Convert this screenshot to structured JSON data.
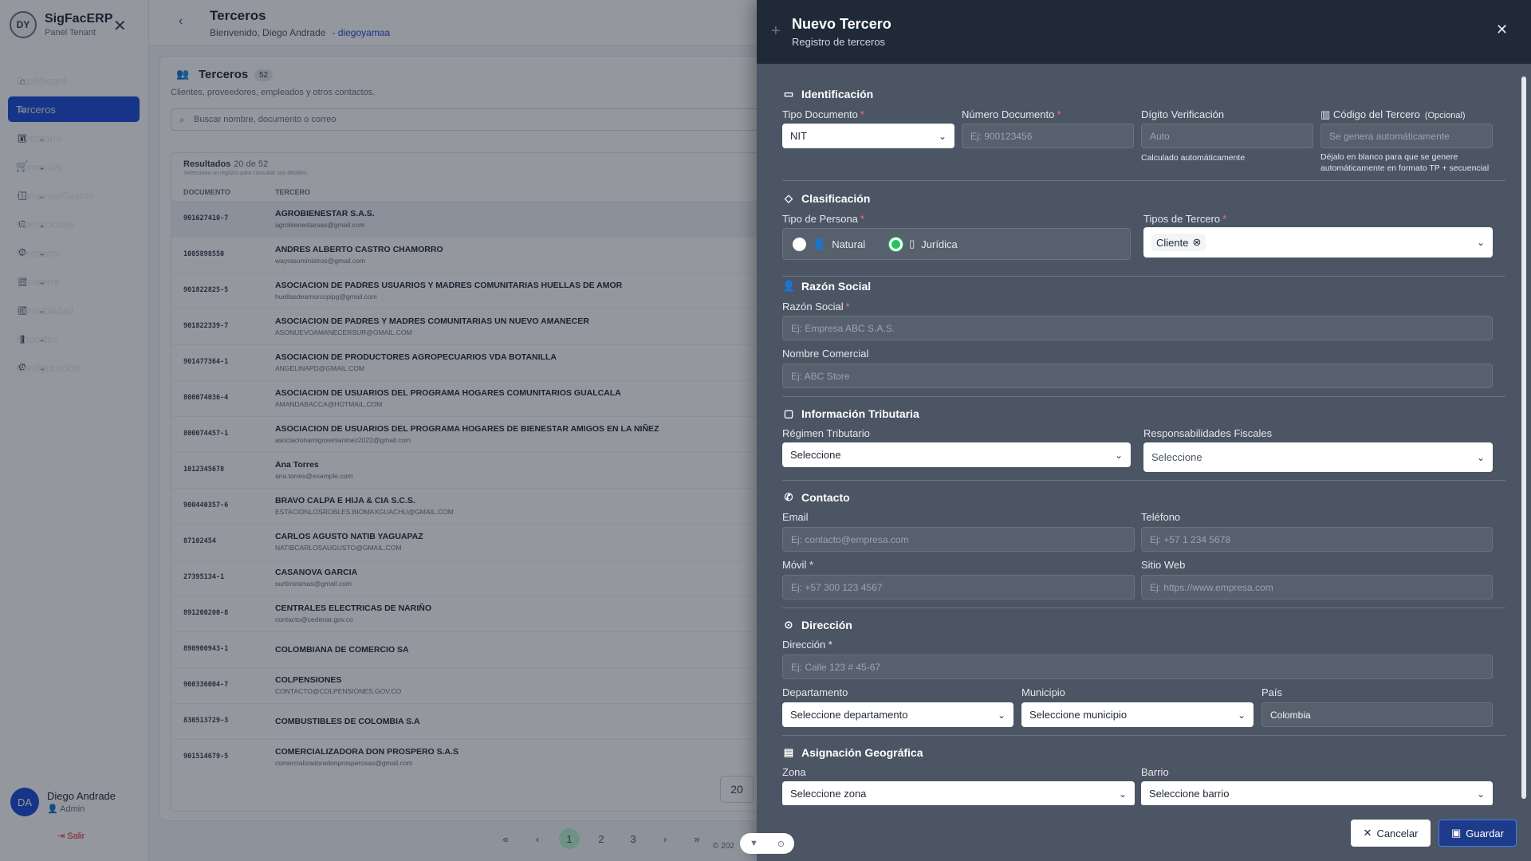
{
  "brand": {
    "title": "SigFacERP",
    "subtitle": "Panel Tenant",
    "logo_text": "DY"
  },
  "sidebar": {
    "items": [
      {
        "label": "Dashboard",
        "icon": "home-icon",
        "chevron": false,
        "active": false
      },
      {
        "label": "Terceros",
        "icon": "id-card-icon",
        "chevron": false,
        "active": true
      },
      {
        "label": "Inventario",
        "icon": "box-icon",
        "chevron": true,
        "active": false
      },
      {
        "label": "Comercial",
        "icon": "cart-icon",
        "chevron": true,
        "active": false
      },
      {
        "label": "Compras/Gastos",
        "icon": "bag-icon",
        "chevron": true,
        "active": false
      },
      {
        "label": "Operaciones",
        "icon": "pin-icon",
        "chevron": true,
        "active": false
      },
      {
        "label": "Procesos",
        "icon": "gear-icon",
        "chevron": true,
        "active": false
      },
      {
        "label": "Tesorería",
        "icon": "wallet-icon",
        "chevron": true,
        "active": false
      },
      {
        "label": "Contabilidad",
        "icon": "ledger-icon",
        "chevron": true,
        "active": false
      },
      {
        "label": "Reportes",
        "icon": "bar-chart-icon",
        "chevron": true,
        "active": false
      },
      {
        "label": "Configuración",
        "icon": "cog-icon",
        "chevron": true,
        "active": false
      }
    ],
    "user": {
      "initials": "DA",
      "name": "Diego Andrade",
      "role": "Admin"
    },
    "logout": "Salir"
  },
  "header": {
    "title": "Terceros",
    "welcome": "Bienvenido, Diego Andrade",
    "username": "- diegoyamaa"
  },
  "list": {
    "title": "Terceros",
    "count": "52",
    "description": "Clientes, proveedores, empleados y otros contactos.",
    "search_placeholder": "Buscar nombre, documento o correo",
    "results_label": "Resultados",
    "results_count": "20 de 52",
    "hint": "Selecciona un registro para consultar sus detalles.",
    "col_doc": "DOCUMENTO",
    "col_tercero": "TERCERO",
    "rows": [
      {
        "doc": "901627410-7",
        "name": "AGROBIENESTAR S.A.S.",
        "email": "agrobienestarsas@gmail.com"
      },
      {
        "doc": "1085898550",
        "name": "ANDRES ALBERTO CASTRO CHAMORRO",
        "email": "wayrasuministros@gmail.com"
      },
      {
        "doc": "901822825-5",
        "name": "ASOCIACION DE PADRES USUARIOS Y MADRES COMUNITARIAS HUELLAS DE AMOR",
        "email": "huellasdeamorccpipg@gmail.com"
      },
      {
        "doc": "901822339-7",
        "name": "ASOCIACION DE PADRES Y MADRES COMUNITARIAS UN NUEVO AMANECER",
        "email": "ASONUEVOAMANECERSUR@GMAIL.COM"
      },
      {
        "doc": "901477364-1",
        "name": "ASOCIACION DE PRODUCTORES AGROPECUARIOS VDA BOTANILLA",
        "email": "ANGELINAPD@GMAIL.COM"
      },
      {
        "doc": "800074036-4",
        "name": "ASOCIACION DE USUARIOS DEL PROGRAMA HOGARES COMUNITARIOS GUALCALA",
        "email": "AMANDABACCA@HOTMAIL.COM"
      },
      {
        "doc": "800074457-1",
        "name": "ASOCIACION DE USUARIOS DEL PROGRAMA HOGARES DE BIENESTAR AMIGOS EN LA NIÑEZ",
        "email": "asociacionamigosenlaninez2022@gmail.com"
      },
      {
        "doc": "1012345678",
        "name": "Ana Torres",
        "email": "ana.torres@example.com"
      },
      {
        "doc": "900440357-6",
        "name": "BRAVO CALPA E HIJA & CIA S.C.S.",
        "email": "ESTACIONLOSROBLES.BIOMAXGUACHU@GMAIL.COM"
      },
      {
        "doc": "87102454",
        "name": "CARLOS AGUSTO NATIB YAGUAPAZ",
        "email": "NATIBCARLOSAUGUSTO@GMAIL.COM"
      },
      {
        "doc": "27395134-1",
        "name": "CASANOVA GARCIA",
        "email": "surtimiramas@gmail.com"
      },
      {
        "doc": "891200200-8",
        "name": "CENTRALES ELECTRICAS DE NARIÑO",
        "email": "contacto@cedenar.gov.co"
      },
      {
        "doc": "890900943-1",
        "name": "COLOMBIANA DE COMERCIO SA",
        "email": ""
      },
      {
        "doc": "900336004-7",
        "name": "COLPENSIONES",
        "email": "CONTACTO@COLPENSIONES.GOV.CO"
      },
      {
        "doc": "830513729-3",
        "name": "COMBUSTIBLES DE COLOMBIA S.A",
        "email": ""
      },
      {
        "doc": "901514679-5",
        "name": "COMERCIALIZADORA DON PROSPERO S.A.S",
        "email": "comercializadoradonprosperosas@gmail.com"
      }
    ],
    "pagination": {
      "first": "«",
      "prev": "‹",
      "pages": [
        "1",
        "2",
        "3"
      ],
      "current": "1",
      "next": "›",
      "last": "»",
      "page_size": "20"
    },
    "footer": "© 202"
  },
  "drawer": {
    "title": "Nuevo Tercero",
    "subtitle": "Registro de terceros",
    "identificacion": {
      "heading": "Identificación",
      "tipo_doc_label": "Tipo Documento",
      "tipo_doc_value": "NIT",
      "numero_doc_label": "Número Documento",
      "numero_doc_placeholder": "Ej: 900123456",
      "digito_label": "Dígito Verificación",
      "digito_placeholder": "Auto",
      "digito_hint": "Calculado automáticamente",
      "codigo_label": "Código del Tercero",
      "codigo_opt": "(Opcional)",
      "codigo_placeholder": "Se genera automáticamente",
      "codigo_hint": "Déjalo en blanco para que se genere automáticamente en formato TP + secuencial"
    },
    "clasificacion": {
      "heading": "Clasificación",
      "tipo_persona_label": "Tipo de Persona",
      "natural": "Natural",
      "juridica": "Jurídica",
      "tipos_tercero_label": "Tipos de Tercero",
      "chip": "Cliente"
    },
    "razon": {
      "heading": "Razón Social",
      "razon_label": "Razón Social",
      "razon_placeholder": "Ej: Empresa ABC S.A.S.",
      "nombre_label": "Nombre Comercial",
      "nombre_placeholder": "Ej: ABC Store"
    },
    "tributaria": {
      "heading": "Información Tributaria",
      "regimen_label": "Régimen Tributario",
      "regimen_value": "Seleccione",
      "resp_label": "Responsabilidades Fiscales",
      "resp_value": "Seleccione"
    },
    "contacto": {
      "heading": "Contacto",
      "email_label": "Email",
      "email_placeholder": "Ej: contacto@empresa.com",
      "tel_label": "Teléfono",
      "tel_placeholder": "Ej: +57 1 234 5678",
      "movil_label": "Móvil *",
      "movil_placeholder": "Ej: +57 300 123 4567",
      "web_label": "Sitio Web",
      "web_placeholder": "Ej: https://www.empresa.com"
    },
    "direccion": {
      "heading": "Dirección",
      "dir_label": "Dirección *",
      "dir_placeholder": "Ej: Calle 123 # 45-67",
      "depto_label": "Departamento",
      "depto_value": "Seleccione departamento",
      "muni_label": "Municipio",
      "muni_value": "Seleccione municipio",
      "pais_label": "País",
      "pais_value": "Colombia"
    },
    "geo": {
      "heading": "Asignación Geográfica",
      "zona_label": "Zona",
      "zona_value": "Seleccione zona",
      "barrio_label": "Barrio",
      "barrio_value": "Seleccione barrio"
    },
    "cancel": "Cancelar",
    "save": "Guardar"
  }
}
